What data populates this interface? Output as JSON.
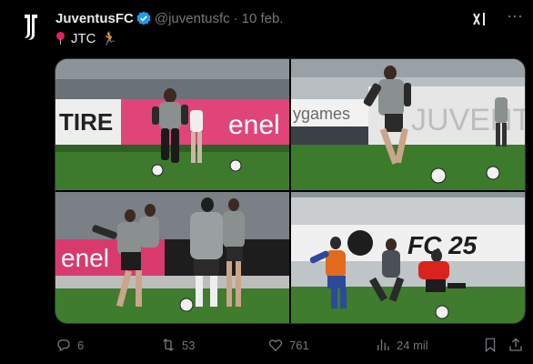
{
  "account": {
    "display_name": "JuventusFC",
    "handle": "@juventusfc",
    "separator": "·",
    "date": "10 feb.",
    "verified": true,
    "avatar_icon": "juventus-logo-icon"
  },
  "header_icons": {
    "grok": "xai-grok-icon",
    "more": "more-icon"
  },
  "tweet": {
    "pin_icon": "round-pushpin-icon",
    "text": "JTC",
    "runner_icon": "person-running-icon"
  },
  "media": {
    "photos": [
      {
        "name": "photo-training-dribble",
        "banner_text": "TIRE",
        "banner_text_2": "enel"
      },
      {
        "name": "photo-training-sprint",
        "banner_text": "ygames",
        "banner_text_2": "JUVENTUS"
      },
      {
        "name": "photo-training-drill",
        "banner_text": "enel"
      },
      {
        "name": "photo-training-goalkeeper",
        "banner_text": "FC 25"
      }
    ]
  },
  "actions": {
    "replies": "6",
    "reposts": "53",
    "likes": "761",
    "views": "24 mil"
  },
  "colors": {
    "background": "#000000",
    "text": "#e7e9ea",
    "muted": "#71767b",
    "verified": "#1d9bf0"
  }
}
